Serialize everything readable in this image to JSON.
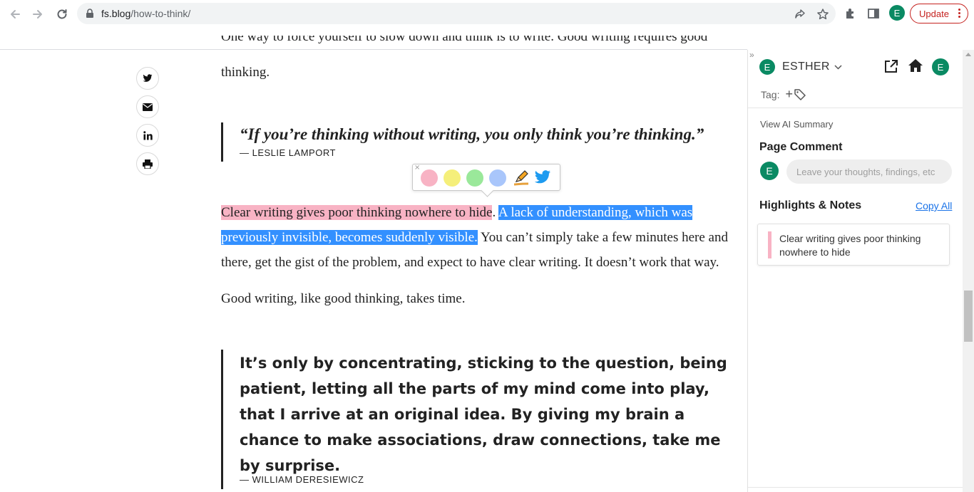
{
  "browser": {
    "url_host": "fs.blog",
    "url_path": "/how-to-think/",
    "profile_initial": "E",
    "update_label": "Update",
    "accent_color": "#0a8a63",
    "update_color": "#c5221f"
  },
  "share": {
    "icons": [
      "twitter-icon",
      "mail-icon",
      "linkedin-icon",
      "print-icon"
    ]
  },
  "article": {
    "top_fragment": "One way to force yourself to slow down and think is to write. Good writing requires good",
    "top_line2": "thinking.",
    "quote1_text": "“If you’re thinking without writing, you only think you’re thinking.”",
    "quote1_author": "— LESLIE LAMPORT",
    "para_highlighted": "Clear writing gives poor thinking nowhere to hide",
    "para_period": ".",
    "para_selected_1": "A lack of understanding, which was",
    "para_selected_2": "previously invisible, becomes suddenly visible.",
    "para_rest_1": " You can’t simply take a few minutes here and",
    "para_rest_2": "there, get the gist of the problem, and expect to have clear writing. It doesn’t work that way.",
    "para2": "Good writing, like good thinking, takes time.",
    "quote2_text": "It’s only by concentrating, sticking to the question, being patient, letting all the parts of my mind come into play, that I arrive at an original idea. By giving my brain a chance to make associations, draw connections, take me by surprise.",
    "quote2_author": "— WILLIAM DERESIEWICZ"
  },
  "popup": {
    "close_glyph": "×",
    "colors": [
      "#f8b3c4",
      "#f5ef7a",
      "#9ae89a",
      "#a9c6fb"
    ],
    "pink": "#f8b3c4",
    "selection": "#3390ff"
  },
  "panel": {
    "collapse_glyph": "»",
    "user_initial": "E",
    "username": "ESTHER",
    "tag_label": "Tag:",
    "tag_add": "+",
    "ai_summary": "View AI Summary",
    "page_comment_title": "Page Comment",
    "comment_placeholder": "Leave your thoughts, findings, etc",
    "highlights_title": "Highlights & Notes",
    "copy_all": "Copy All",
    "notes": [
      {
        "text": "Clear writing gives poor thinking nowhere to hide",
        "color": "#f8b3c4"
      }
    ]
  }
}
